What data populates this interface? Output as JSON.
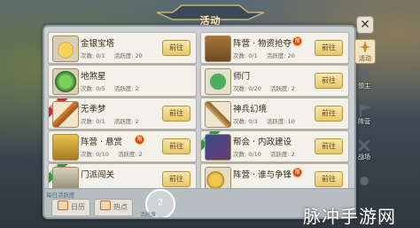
{
  "window": {
    "title": "活动"
  },
  "cards": [
    {
      "name": "金银宝塔",
      "times": "次数: 0/1",
      "active": "活跃度: 20",
      "button": "前往",
      "badge": "",
      "ribbon": ""
    },
    {
      "name": "阵营 · 物资抢夺",
      "times": "次数: 0/1",
      "active": "活跃度: 20",
      "button": "前往",
      "badge": "限",
      "ribbon": ""
    },
    {
      "name": "地煞星",
      "times": "次数: 0/5",
      "active": "活跃度: 2",
      "button": "",
      "badge": "",
      "ribbon": ""
    },
    {
      "name": "师门",
      "times": "次数: 0/20",
      "active": "活跃度: 2",
      "button": "前往",
      "badge": "",
      "ribbon": ""
    },
    {
      "name": "无季梦",
      "times": "次数: 0/1",
      "active": "活跃度: 2",
      "button": "前往",
      "badge": "",
      "ribbon": "推荐"
    },
    {
      "name": "神兵幻境",
      "times": "次数: 0/3",
      "active": "活跃度: 10",
      "button": "前往",
      "badge": "",
      "ribbon": ""
    },
    {
      "name": "阵营 · 悬赏",
      "times": "次数: 0/10",
      "active": "活跃度: 2",
      "button": "前往",
      "badge": "限",
      "ribbon": ""
    },
    {
      "name": "帮会 · 内政建设",
      "times": "次数: 0/10",
      "active": "活跃度: 2",
      "button": "前往",
      "badge": "",
      "ribbon": "推荐"
    },
    {
      "name": "门派闯关",
      "times": "",
      "active": "",
      "button": "前往",
      "badge": "",
      "ribbon": "推荐"
    },
    {
      "name": "阵营 · 谁与争锋",
      "times": "",
      "active": "",
      "button": "前往",
      "badge": "限",
      "ribbon": ""
    }
  ],
  "bottom": {
    "partial_text": "每日活跃度",
    "tab1": "日历",
    "tab2": "热点",
    "live_value": "2",
    "live_label": "活跃度"
  },
  "side": [
    {
      "label": "活动",
      "icon": "compass-icon",
      "active": true
    },
    {
      "label": "领主",
      "icon": "helmet-icon",
      "active": false
    },
    {
      "label": "阵营",
      "icon": "flag-icon",
      "active": false
    },
    {
      "label": "战场",
      "icon": "crossed-swords-icon",
      "active": false
    },
    {
      "label": "",
      "icon": "gear-icon",
      "active": false
    }
  ],
  "watermark": "脉冲手游网",
  "colors": {
    "button_gold": "#e6c86a",
    "ribbon_red": "#c8302c",
    "ribbon_green": "#2e9a46",
    "panel": "#c9cfd2"
  }
}
